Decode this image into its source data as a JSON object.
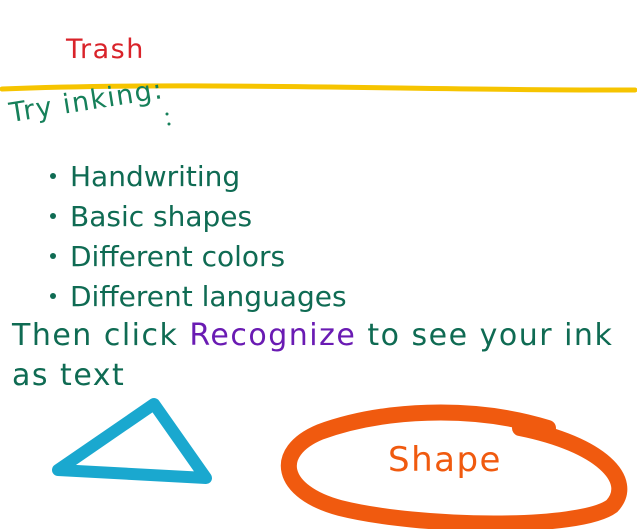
{
  "header": {
    "title": "Trash"
  },
  "intro": {
    "text": "Try inking:"
  },
  "bullets": [
    {
      "label": "Handwriting"
    },
    {
      "label": "Basic shapes"
    },
    {
      "label": "Different colors"
    },
    {
      "label": "Different languages"
    }
  ],
  "instructions": {
    "prefix": "Then click ",
    "link": "Recognize",
    "suffix": " to see your ink",
    "line2": "as text"
  },
  "shapes": {
    "label": "Shape",
    "triangle_color": "#1aa8cf",
    "circle_color": "#f05a0f",
    "divider_color": "#f6c400"
  },
  "colors": {
    "title": "#d9232a",
    "ink_green": "#0f6b53",
    "link_purple": "#6a1bb3",
    "shape_orange": "#f05a0f"
  }
}
